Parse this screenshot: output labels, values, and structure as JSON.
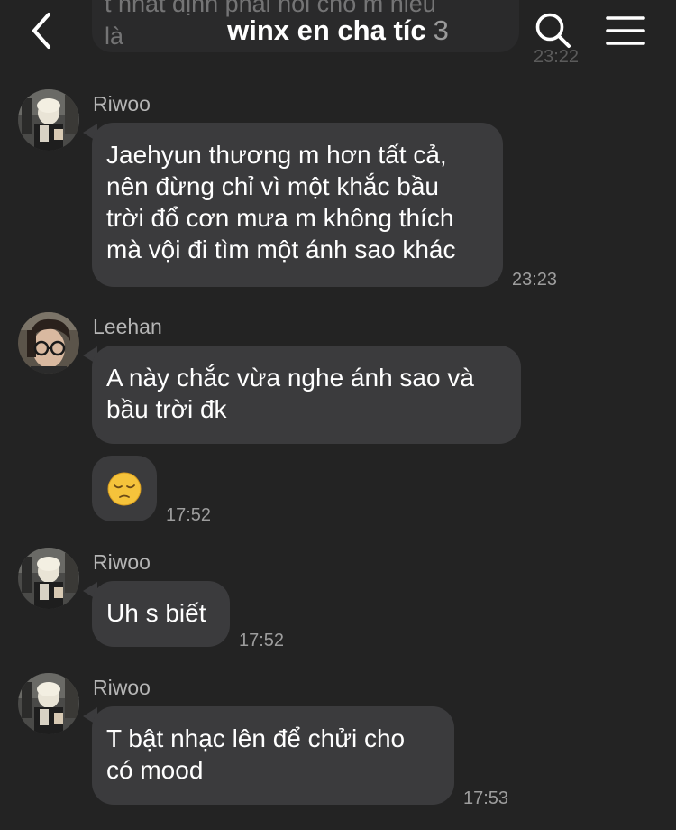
{
  "header": {
    "title": "winx en cha tíc",
    "member_count": "3",
    "back_icon": "chevron-left-icon",
    "search_icon": "search-icon",
    "menu_icon": "hamburger-menu-icon"
  },
  "previous_message": {
    "text": "t nhất định phải nói cho m hiểu\nlà",
    "time": "23:22"
  },
  "messages": [
    {
      "sender": "Riwoo",
      "lines": [
        "Jaehyun thương m hơn tất cả,",
        "nên đừng chỉ vì một khắc bầu",
        "trời đổ cơn mưa m không thích",
        "mà vội đi tìm một ánh sao khác"
      ],
      "time": "23:23"
    },
    {
      "sender": "Leehan",
      "lines": [
        "A này chắc vừa nghe ánh sao và",
        "bầu trời đk"
      ],
      "time": ""
    },
    {
      "sender": "Leehan",
      "emoji": "😔",
      "emoji_name": "pensive-face-emoji",
      "time": "17:52"
    },
    {
      "sender": "Riwoo",
      "lines": [
        "Uh s biết"
      ],
      "time": "17:52"
    },
    {
      "sender": "Riwoo",
      "lines": [
        "T bật nhạc lên để chửi cho",
        "có mood"
      ],
      "time": "17:53"
    }
  ],
  "colors": {
    "background": "#232323",
    "bubble": "#3b3b3d",
    "text": "#ffffff",
    "secondary_text": "#9d9d9d",
    "member_count": "#9a9a9a"
  }
}
